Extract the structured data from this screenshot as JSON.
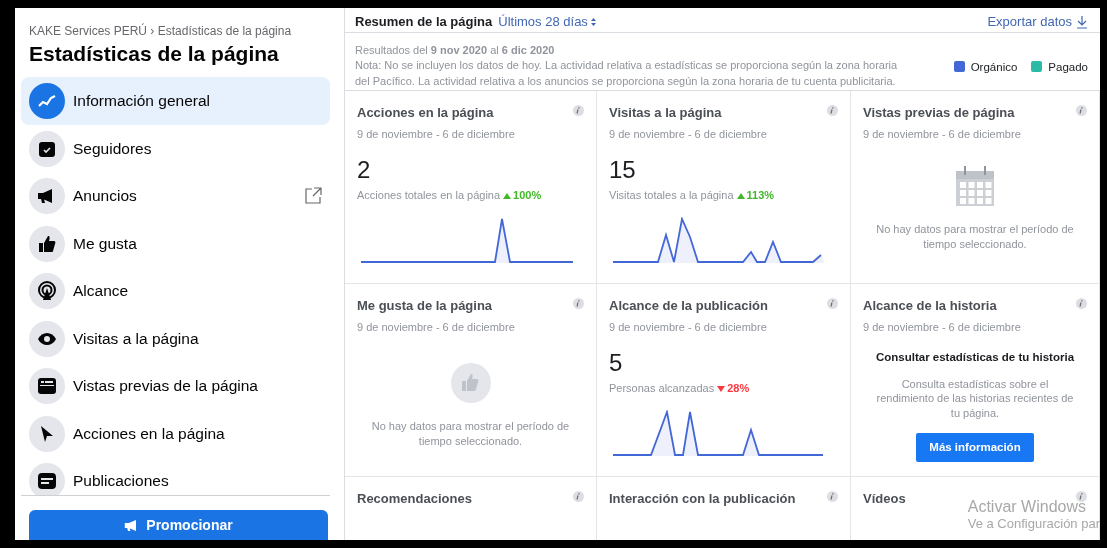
{
  "sidebar": {
    "breadcrumb": "KAKE Services PERÚ › Estadísticas de la página",
    "title": "Estadísticas de la página",
    "items": [
      {
        "label": "Información general",
        "selected": true,
        "external": false
      },
      {
        "label": "Seguidores",
        "selected": false,
        "external": false
      },
      {
        "label": "Anuncios",
        "selected": false,
        "external": true
      },
      {
        "label": "Me gusta",
        "selected": false,
        "external": false
      },
      {
        "label": "Alcance",
        "selected": false,
        "external": false
      },
      {
        "label": "Visitas a la página",
        "selected": false,
        "external": false
      },
      {
        "label": "Vistas previas de la página",
        "selected": false,
        "external": false
      },
      {
        "label": "Acciones en la página",
        "selected": false,
        "external": false
      },
      {
        "label": "Publicaciones",
        "selected": false,
        "external": false
      }
    ],
    "promote_button": "Promocionar"
  },
  "header": {
    "title": "Resumen de la página",
    "period": "Últimos 28 días",
    "export": "Exportar datos"
  },
  "note": {
    "results": "Resultados del **9 nov 2020** al **6 dic 2020**",
    "text": "Nota: No se incluyen los datos de hoy. La actividad relativa a estadísticas se proporciona según la zona horaria del Pacífico. La actividad relativa a los anuncios se proporciona según la zona horaria de tu cuenta publicitaria."
  },
  "legend": [
    {
      "label": "Orgánico",
      "color": "#4267d6"
    },
    {
      "label": "Pagado",
      "color": "#2abba7"
    }
  ],
  "cards": [
    {
      "kind": "metric",
      "title": "Acciones en la página",
      "range": "9 de noviembre - 6 de diciembre",
      "value": "2",
      "caption": "Acciones totales en la página",
      "trend": {
        "rising": true,
        "value": "100%"
      }
    },
    {
      "kind": "metric",
      "title": "Visitas a la página",
      "range": "9 de noviembre - 6 de diciembre",
      "value": "15",
      "caption": "Visitas totales a la página",
      "trend": {
        "rising": true,
        "value": "113%"
      }
    },
    {
      "kind": "empty",
      "title": "Vistas previas de página",
      "range": "9 de noviembre - 6 de diciembre",
      "message": "No hay datos para mostrar el período de tiempo seleccionado."
    },
    {
      "kind": "empty",
      "title": "Me gusta de la página",
      "range": "9 de noviembre - 6 de diciembre",
      "message": "No hay datos para mostrar el período de tiempo seleccionado."
    },
    {
      "kind": "metric",
      "title": "Alcance de la publicación",
      "range": "9 de noviembre - 6 de diciembre",
      "value": "5",
      "caption": "Personas alcanzadas",
      "trend": {
        "rising": false,
        "value": "28%"
      }
    },
    {
      "kind": "story",
      "title": "Alcance de la historia",
      "range": "9 de noviembre - 6 de diciembre",
      "heading": "Consultar estadísticas de tu historia",
      "message": "Consulta estadísticas sobre el rendimiento de las historias recientes de tu página.",
      "button": "Más información"
    },
    {
      "kind": "cut",
      "title": "Recomendaciones"
    },
    {
      "kind": "cut",
      "title": "Interacción con la publicación"
    },
    {
      "kind": "cut",
      "title": "Vídeos"
    }
  ],
  "windows_notice": {
    "title": "Activar Windows",
    "text": "Ve a Configuración par"
  }
}
